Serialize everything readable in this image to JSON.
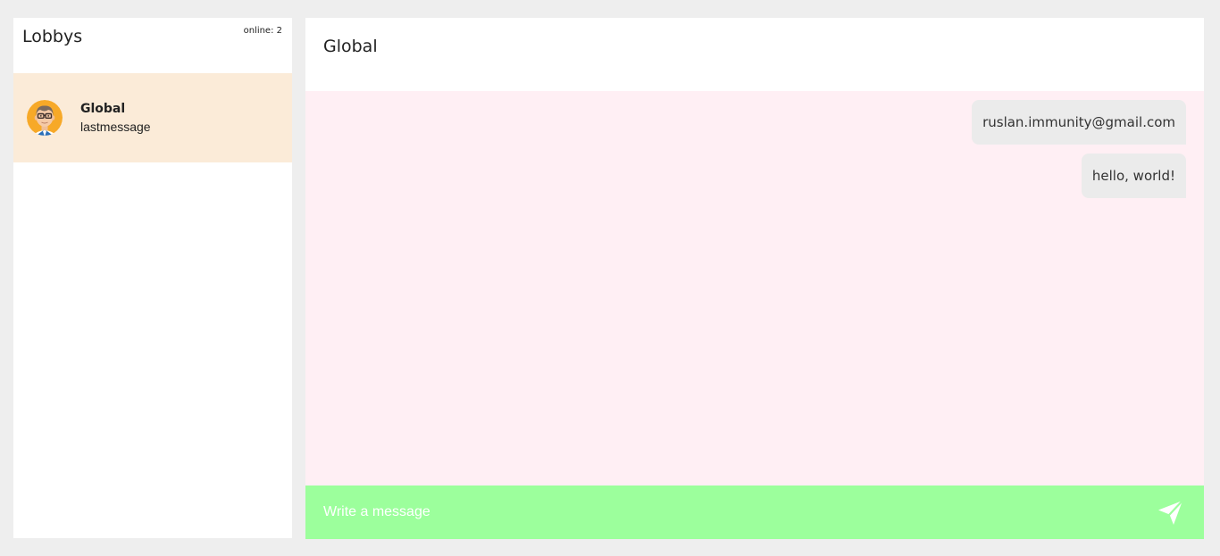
{
  "sidebar": {
    "title": "Lobbys",
    "online_count": "online: 2",
    "lobbies": [
      {
        "name": "Global",
        "last_message": "lastmessage",
        "avatar_icon": "user-avatar-icon"
      }
    ]
  },
  "chat": {
    "title": "Global",
    "messages": [
      {
        "text": "ruslan.immunity@gmail.com"
      },
      {
        "text": "hello, world!"
      }
    ],
    "input": {
      "value": "",
      "placeholder": "Write a message"
    },
    "send_icon": "paper-plane-icon"
  },
  "colors": {
    "page_background": "#eeeeee",
    "panel_background": "#ffffff",
    "active_lobby": "#fbebd8",
    "messages_background": "#ffeff4",
    "message_bubble": "#ebebeb",
    "composer_background": "#9cff9c",
    "composer_text": "#ffffff"
  }
}
